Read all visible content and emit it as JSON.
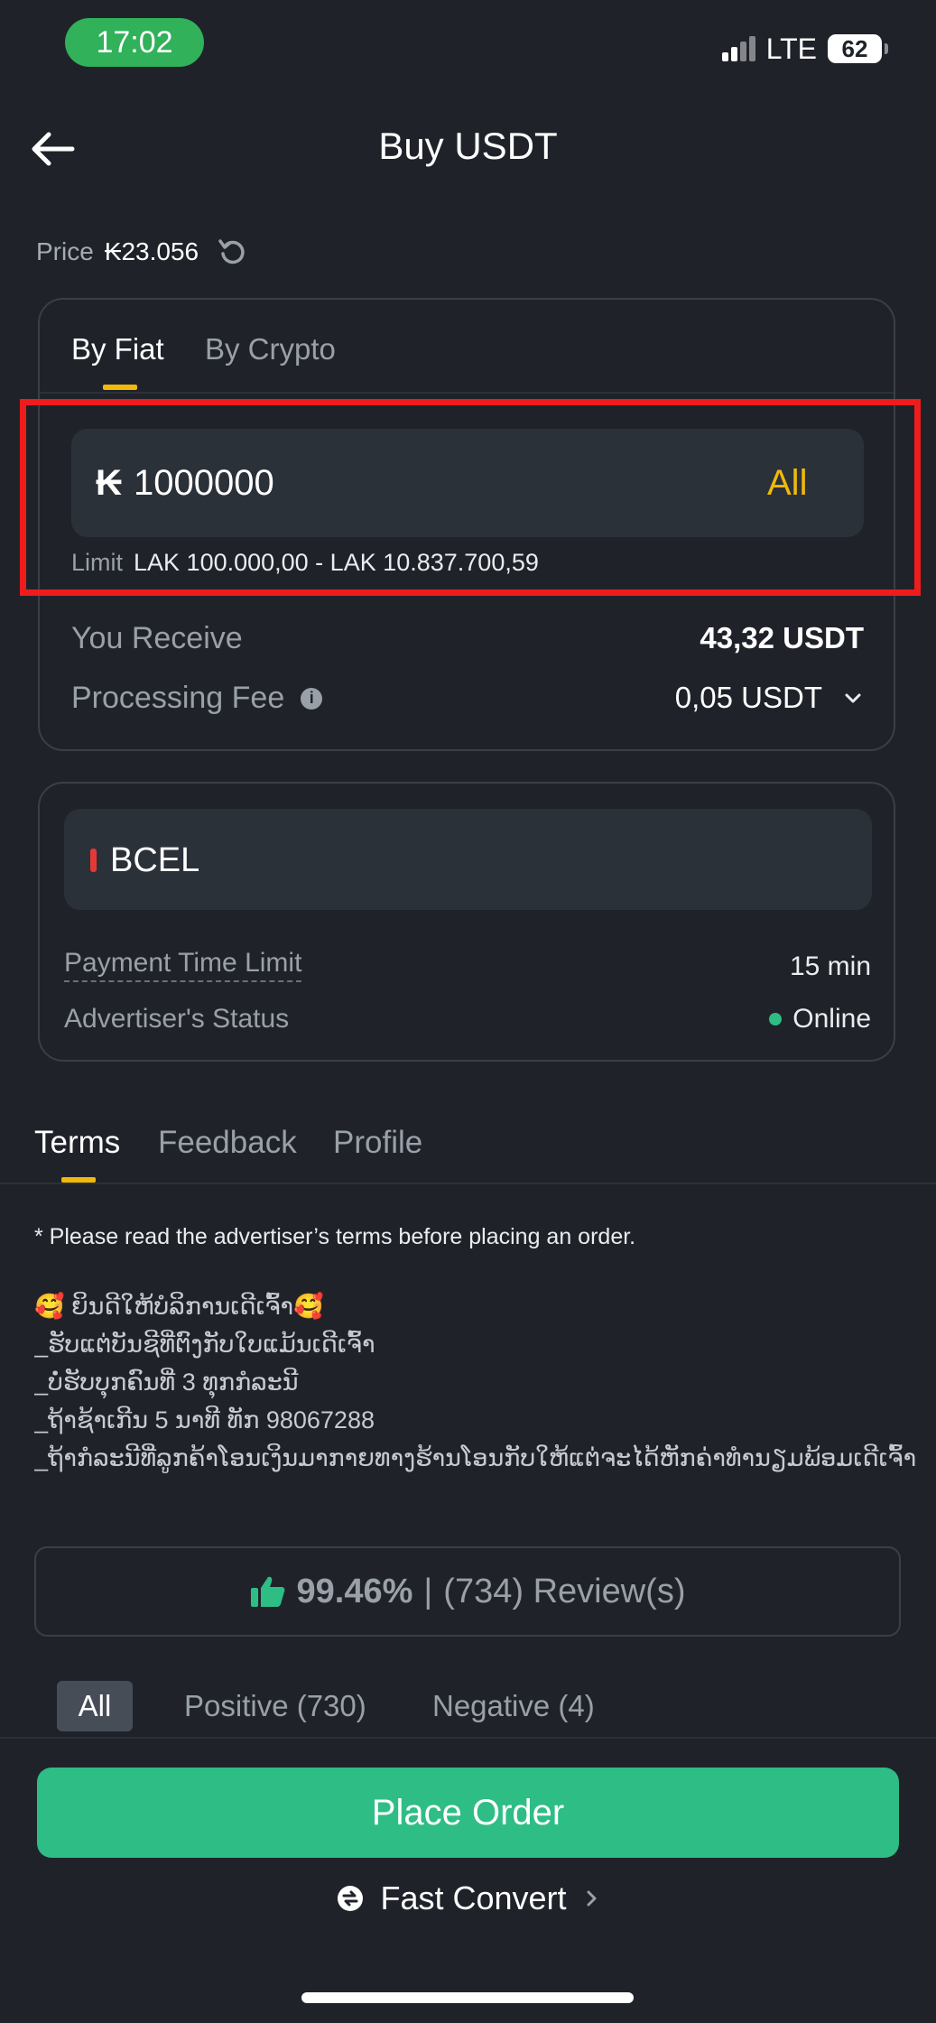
{
  "status_bar": {
    "time": "17:02",
    "network": "LTE",
    "battery": "62"
  },
  "header": {
    "title": "Buy USDT"
  },
  "price": {
    "label": "Price",
    "value": "₭23.056"
  },
  "trade_tabs": [
    "By Fiat",
    "By Crypto"
  ],
  "amount_input": {
    "symbol": "₭",
    "value": "1000000",
    "all_label": "All"
  },
  "limit": {
    "label": "Limit",
    "value": "LAK 100.000,00 - LAK 10.837.700,59"
  },
  "receive": {
    "label": "You Receive",
    "value": "43,32 USDT"
  },
  "fee": {
    "label": "Processing Fee",
    "value": "0,05 USDT"
  },
  "payment": {
    "bank": "BCEL",
    "time_limit_label": "Payment Time Limit",
    "time_limit_value": "15 min",
    "status_label": "Advertiser's Status",
    "status_value": "Online"
  },
  "info_tabs": [
    "Terms",
    "Feedback",
    "Profile"
  ],
  "terms": {
    "note": "*  Please read the advertiser’s terms before placing an order.",
    "lines": [
      "🥰 ຍິນດີໃຫ້ບໍລິການເດີເຈົ້າ🥰",
      "_ຮັບແຕ່ບັນຊີທີ່ຕົງກັບໃບແມ້ນເດີເຈົ້າ",
      "_ບໍ່ຮັບບຸກຄົນທີ່ 3 ທຸກກໍລະນີ",
      "_ຖ້າຊ້າເກີນ 5 ນາທີ ທັກ 98067288",
      "_ຖ້າກໍລະນີທີ່ລູກຄ້າໂອນເງິນມາກາຍທາງຮ້ານໂອນກັບໃຫ້ແຕ່ຈະໄດ້ຫັກຄ່າທຳນຽມພ້ອມເດີເຈົ້າ"
    ]
  },
  "reviews": {
    "percent": "99.46%",
    "separator": "|",
    "count_text": "(734) Review(s)"
  },
  "review_filters": [
    "All",
    "Positive (730)",
    "Negative (4)"
  ],
  "actions": {
    "place_order": "Place Order",
    "fast_convert": "Fast Convert"
  },
  "colors": {
    "background": "#1f2329",
    "accent": "#f0b90b",
    "success": "#2ebd85",
    "highlight": "#ee1c1c"
  }
}
